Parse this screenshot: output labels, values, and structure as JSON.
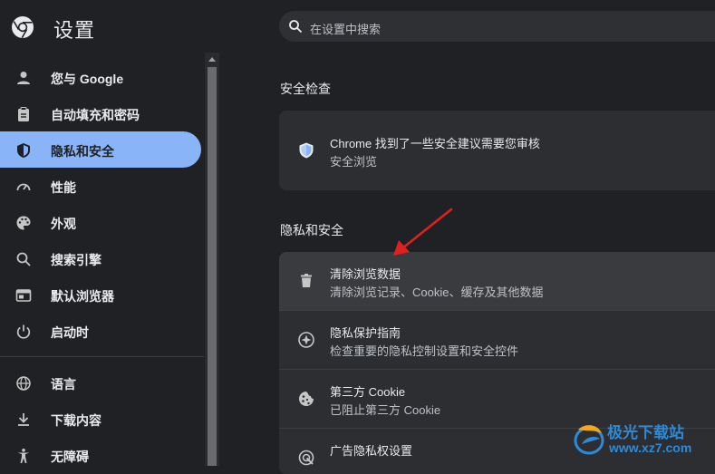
{
  "header": {
    "title": "设置",
    "search_placeholder": "在设置中搜索"
  },
  "sidebar": {
    "items": [
      {
        "label": "您与 Google",
        "icon": "person-icon"
      },
      {
        "label": "自动填充和密码",
        "icon": "clipboard-icon"
      },
      {
        "label": "隐私和安全",
        "icon": "shield-icon",
        "active": true
      },
      {
        "label": "性能",
        "icon": "speedometer-icon"
      },
      {
        "label": "外观",
        "icon": "palette-icon"
      },
      {
        "label": "搜索引擎",
        "icon": "search-icon"
      },
      {
        "label": "默认浏览器",
        "icon": "browser-icon"
      },
      {
        "label": "启动时",
        "icon": "power-icon"
      },
      {
        "label": "语言",
        "icon": "globe-icon"
      },
      {
        "label": "下载内容",
        "icon": "download-icon"
      },
      {
        "label": "无障碍",
        "icon": "accessibility-icon"
      }
    ]
  },
  "safety_check": {
    "title": "安全检查",
    "item": {
      "title": "Chrome 找到了一些安全建议需要您审核",
      "subtitle": "安全浏览"
    }
  },
  "privacy": {
    "title": "隐私和安全",
    "rows": [
      {
        "title": "清除浏览数据",
        "subtitle": "清除浏览记录、Cookie、缓存及其他数据",
        "icon": "trash-icon"
      },
      {
        "title": "隐私保护指南",
        "subtitle": "检查重要的隐私控制设置和安全控件",
        "icon": "compass-icon"
      },
      {
        "title": "第三方 Cookie",
        "subtitle": "已阻止第三方 Cookie",
        "icon": "cookie-icon"
      },
      {
        "title": "广告隐私权设置",
        "subtitle": "",
        "icon": "ad-privacy-icon"
      }
    ]
  },
  "watermark": {
    "line1": "极光下载站",
    "line2": "www.xz7.com"
  },
  "colors": {
    "accent": "#8ab4f8",
    "background": "#202124",
    "card": "#2d2e31",
    "arrow": "#e02020"
  }
}
